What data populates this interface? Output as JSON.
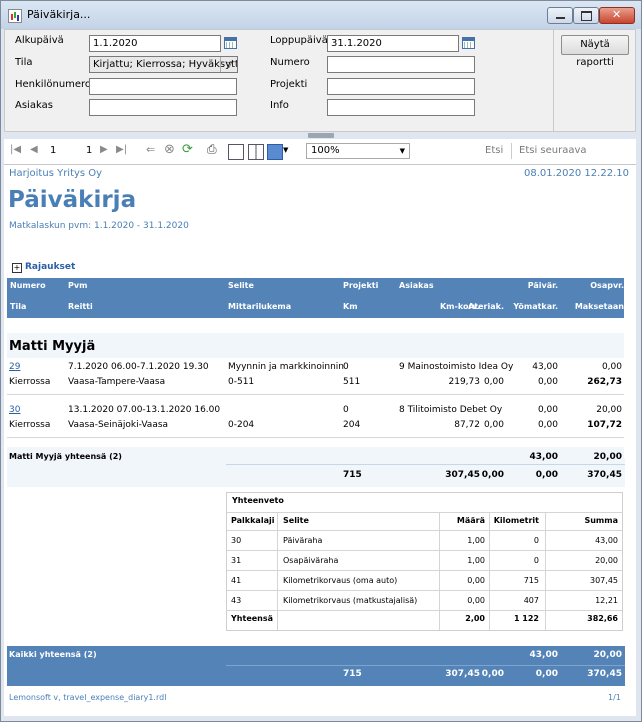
{
  "window": {
    "title": "Päiväkirja..."
  },
  "params": {
    "start_label": "Alkupäivä",
    "start_value": "1.1.2020",
    "end_label": "Loppupäivä",
    "end_value": "31.1.2020",
    "status_label": "Tila",
    "status_value": "Kirjattu; Kierrossa; Hyväksytty;",
    "number_label": "Numero",
    "number_value": "",
    "person_label": "Henkilönumero",
    "person_value": "",
    "project_label": "Projekti",
    "project_value": "",
    "customer_label": "Asiakas",
    "customer_value": "",
    "info_label": "Info",
    "info_value": "",
    "show_report": "Näytä raportti"
  },
  "toolbar": {
    "page_current": "1",
    "page_total": "1",
    "zoom": "100%",
    "find": "Etsi",
    "find_next": "Etsi seuraava",
    "icons": [
      "first-page-icon",
      "prev-page-icon",
      "next-page-icon",
      "last-page-icon",
      "back-icon",
      "stop-icon",
      "refresh-icon",
      "print-icon",
      "print-layout-icon",
      "page-setup-icon",
      "export-icon"
    ]
  },
  "report": {
    "company": "Harjoitus Yritys Oy",
    "datetime": "08.01.2020 12.22.10",
    "title": "Päiväkirja",
    "subtitle": "Matkalaskun pvm: 1.1.2020 - 31.1.2020",
    "filters_label": "Rajaukset",
    "header_row1": [
      "Numero",
      "Pvm",
      "Selite",
      "Projekti",
      "Asiakas",
      "Päivär.",
      "Osapvr."
    ],
    "header_row2": [
      "Tila",
      "Reitti",
      "Mittarilukema",
      "Km",
      "Km-korv.",
      "Ateriak.",
      "Yömatkar.",
      "Maksetaan"
    ],
    "person_name": "Matti Myyjä",
    "entries": [
      {
        "number": "29",
        "date": "7.1.2020 06.00-7.1.2020 19.30",
        "desc": "Myynnin ja markkinoinnin",
        "project": "0",
        "customer": "9 Mainostoimisto Idea Oy",
        "daily": "43,00",
        "partial": "0,00",
        "status": "Kierrossa",
        "route": "Vaasa-Tampere-Vaasa",
        "meter": "0-511",
        "km": "511",
        "km_comp": "219,73",
        "meal": "0,00",
        "night": "0,00",
        "payable": "262,73"
      },
      {
        "number": "30",
        "date": "13.1.2020 07.00-13.1.2020 16.00",
        "desc": "",
        "project": "0",
        "customer": "8 Tilitoimisto Debet Oy",
        "daily": "0,00",
        "partial": "20,00",
        "status": "Kierrossa",
        "route": "Vaasa-Seinäjoki-Vaasa",
        "meter": "0-204",
        "km": "204",
        "km_comp": "87,72",
        "meal": "0,00",
        "night": "0,00",
        "payable": "107,72"
      }
    ],
    "person_total": {
      "label": "Matti Myyjä yhteensä (2)",
      "daily": "43,00",
      "partial": "20,00",
      "km": "715",
      "km_comp": "307,45",
      "meal": "0,00",
      "night": "0,00",
      "payable": "370,45"
    },
    "summary": {
      "title": "Yhteenveto",
      "headers": [
        "Palkkalaji",
        "Selite",
        "Määrä",
        "Kilometrit",
        "Summa"
      ],
      "rows": [
        [
          "30",
          "Päiväraha",
          "1,00",
          "0",
          "43,00"
        ],
        [
          "31",
          "Osapäiväraha",
          "1,00",
          "0",
          "20,00"
        ],
        [
          "41",
          "Kilometrikorvaus (oma auto)",
          "0,00",
          "715",
          "307,45"
        ],
        [
          "43",
          "Kilometrikorvaus (matkustajalisä)",
          "0,00",
          "407",
          "12,21"
        ]
      ],
      "total": [
        "Yhteensä",
        "",
        "2,00",
        "1 122",
        "382,66"
      ]
    },
    "grand_total": {
      "label": "Kaikki yhteensä (2)",
      "daily": "43,00",
      "partial": "20,00",
      "km": "715",
      "km_comp": "307,45",
      "meal": "0,00",
      "night": "0,00",
      "payable": "370,45"
    },
    "footer_left": "Lemonsoft v, travel_expense_diary1.rdl",
    "footer_right": "1/1"
  },
  "colors": {
    "header_bar": "#5383b7",
    "title_blue": "#4a7fb5",
    "link_blue": "#2b5fa5"
  }
}
